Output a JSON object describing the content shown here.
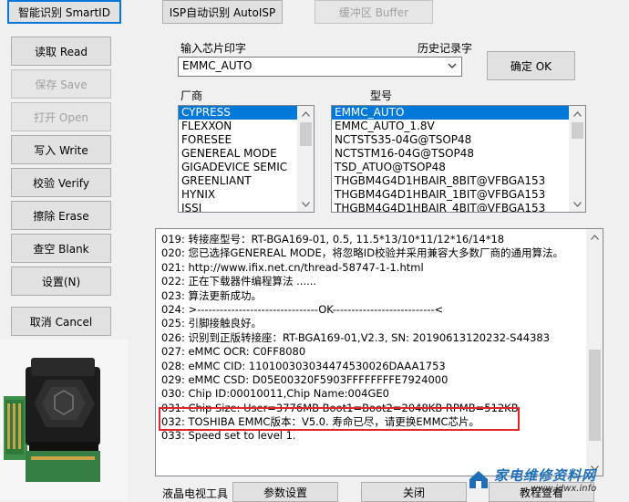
{
  "top_tabs": {
    "smart_id": "智能识别 SmartID",
    "isp_auto": "ISP自动识别 AutoISP",
    "buffer": "缓冲区 Buffer"
  },
  "left_buttons": {
    "read": "读取 Read",
    "save": "保存 Save",
    "open": "打开 Open",
    "write": "写入 Write",
    "verify": "校验 Verify",
    "erase": "擦除 Erase",
    "blank": "查空 Blank",
    "settings": "设置(N)",
    "cancel": "取消 Cancel"
  },
  "chip_input": {
    "label": "输入芯片印字",
    "history_label": "历史记录字",
    "value": "EMMC_AUTO",
    "ok_button": "确定 OK"
  },
  "vendor_list": {
    "label": "厂商",
    "items": [
      "CYPRESS",
      "FLEXXON",
      "FORESEE",
      "GENEREAL MODE",
      "GIGADEVICE SEMIC",
      "GREENLIANT",
      "HYNIX",
      "ISSI"
    ],
    "selected_index": 0
  },
  "model_list": {
    "label": "型号",
    "items": [
      "EMMC_AUTO",
      "EMMC_AUTO_1.8V",
      "NCTSTS35-04G@TSOP48",
      "NCTSTM16-04G@TSOP48",
      "TSD_ATUO@TSOP48",
      "THGBM4G4D1HBAIR_8BIT@VFBGA153",
      "THGBM4G4D1HBAIR_1BIT@VFBGA153",
      "THGBM4G4D1HBAIR_4BIT@VFBGA153"
    ],
    "selected_index": 0
  },
  "log": {
    "lines": [
      "019: 转接座型号：RT-BGA169-01, 0.5, 11.5*13/10*11/12*16/14*18",
      "020: 您已选择GENEREAL MODE，将忽略ID校验并采用兼容大多数厂商的通用算法。",
      "021: http://www.ifix.net.cn/thread-58747-1-1.html",
      "022: 正在下载器件编程算法 ......",
      "023: 算法更新成功。",
      "024: >--------------------------------OK---------------------------<",
      "025: 引脚接触良好。",
      "026: 识别到正版转接座：RT-BGA169-01,V2.3, SN: 20190613120232-S44383",
      "027: eMMC OCR: C0FF8080",
      "028: eMMC CID:  110100303034474530026DAAA1753",
      "029: eMMC CSD: D05E00320F5903FFFFFFFFE7924000",
      "030: Chip ID:00010011,Chip Name:004GE0",
      "031: Chip Size: User=3776MB Boot1=Boot2=2048KB RPMB=512KB",
      "032: TOSHIBA EMMC版本：V5.0.  寿命已尽，请更换EMMC芯片。",
      "033: Speed set to level 1."
    ]
  },
  "bottom_bar": {
    "lcd_tools": "液晶电视工具",
    "params": "参数设置",
    "close": "关闭",
    "tutorial": "教程查看"
  },
  "watermark": {
    "text": "家电维修资料网",
    "url": "www.jdwx.info"
  },
  "colors": {
    "selection": "#0078d7",
    "highlight_border": "#e0262b",
    "watermark_text": "#1f6fb8",
    "watermark_url": "#2b2b2b"
  }
}
